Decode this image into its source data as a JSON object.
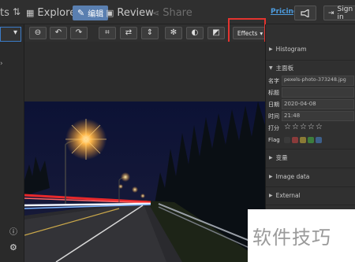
{
  "topnav": {
    "cut_label": "ts",
    "sort_icon": "sort-arrows-icon",
    "tabs": [
      {
        "label": "Explore",
        "icon": "grid-icon"
      },
      {
        "label": "编辑",
        "icon": "pencil-icon"
      },
      {
        "label": "Review",
        "icon": "image-icon"
      },
      {
        "label": "Share",
        "icon": "share-icon"
      }
    ],
    "pricing": "Pricing",
    "signin": "Sign in"
  },
  "toolbar": {
    "effects": "Effects",
    "icons": [
      "minus-icon",
      "rotate-left-icon",
      "rotate-right-icon",
      "crop-icon",
      "transform-icon",
      "flip-icon",
      "gear-icon",
      "contrast-icon",
      "levels-icon",
      "undo-icon",
      "redo-icon"
    ]
  },
  "right_panel": {
    "histogram": "Histogram",
    "main": "主面板",
    "name_label": "名字",
    "name_value": "pexels-photo-373248.jpg",
    "title_label": "标题",
    "date_label": "日期",
    "date_value": "2020-04-08",
    "time_label": "时间",
    "time_value": "21:48",
    "rating_label": "打分",
    "rating": 0,
    "flag_label": "Flag",
    "flag_colors": [
      "#3a3a3a",
      "#8a3b3b",
      "#8a7a35",
      "#3d7d3d",
      "#3d5f8a"
    ],
    "variables": "变量",
    "image_data": "Image data",
    "external": "External"
  },
  "watermark": "软件技巧",
  "colors": {
    "accent": "#5a7fb0",
    "highlight": "#e3342f",
    "link": "#4d9de0"
  }
}
